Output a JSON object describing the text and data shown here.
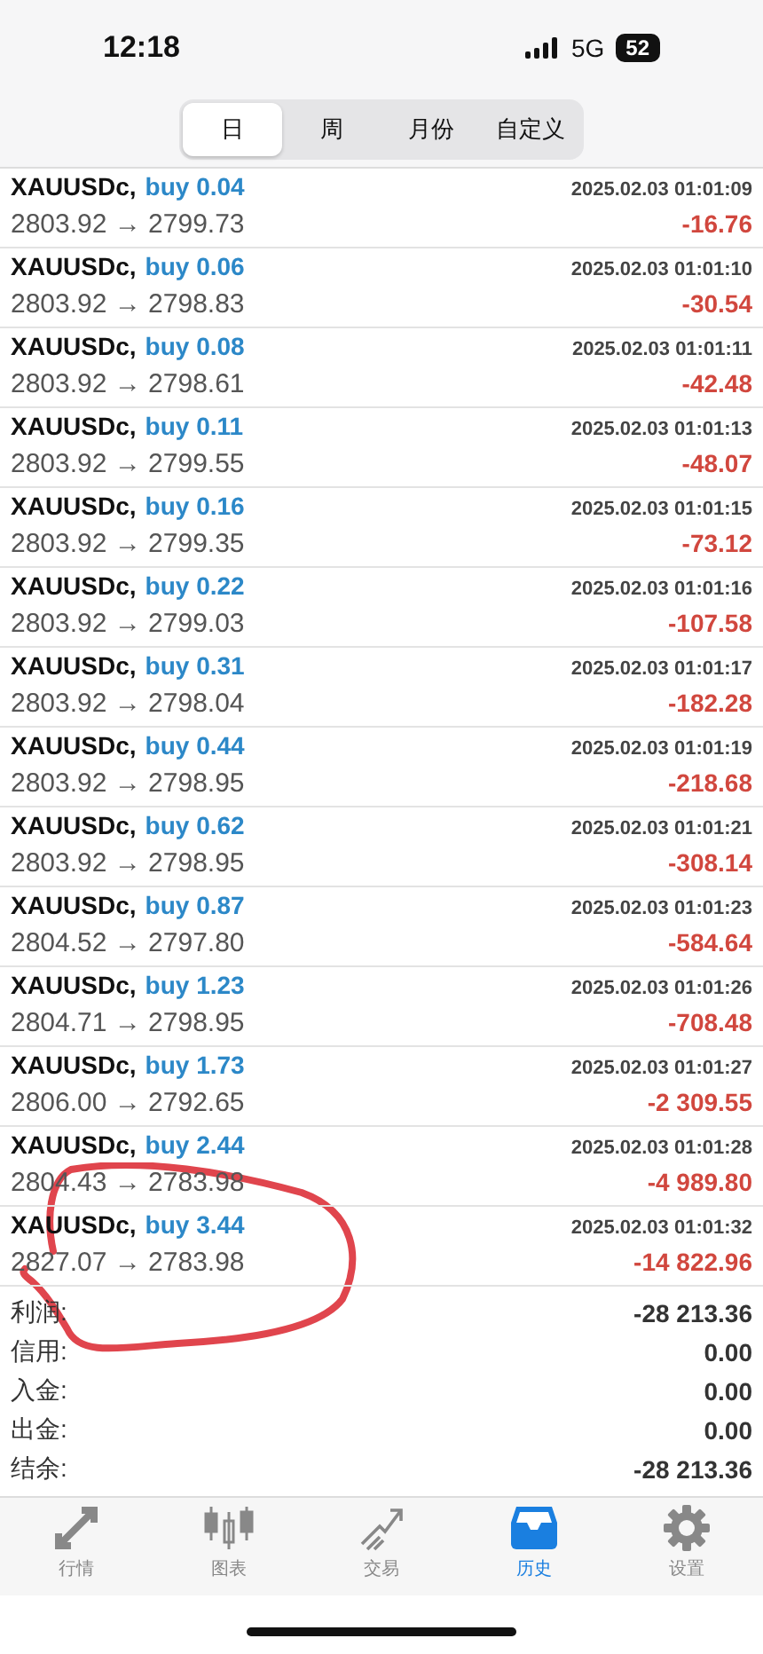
{
  "status_bar": {
    "time": "12:18",
    "network": "5G",
    "battery": "52"
  },
  "period_tabs": [
    {
      "label": "日",
      "selected": true
    },
    {
      "label": "周",
      "selected": false
    },
    {
      "label": "月份",
      "selected": false
    },
    {
      "label": "自定义",
      "selected": false
    }
  ],
  "deals": [
    {
      "symbol": "XAUUSDc,",
      "side": "buy 0.04",
      "time": "2025.02.03 01:01:09",
      "prices": "2803.92 → 2799.73",
      "profit": "-16.76"
    },
    {
      "symbol": "XAUUSDc,",
      "side": "buy 0.06",
      "time": "2025.02.03 01:01:10",
      "prices": "2803.92 → 2798.83",
      "profit": "-30.54"
    },
    {
      "symbol": "XAUUSDc,",
      "side": "buy 0.08",
      "time": "2025.02.03 01:01:11",
      "prices": "2803.92 → 2798.61",
      "profit": "-42.48"
    },
    {
      "symbol": "XAUUSDc,",
      "side": "buy 0.11",
      "time": "2025.02.03 01:01:13",
      "prices": "2803.92 → 2799.55",
      "profit": "-48.07"
    },
    {
      "symbol": "XAUUSDc,",
      "side": "buy 0.16",
      "time": "2025.02.03 01:01:15",
      "prices": "2803.92 → 2799.35",
      "profit": "-73.12"
    },
    {
      "symbol": "XAUUSDc,",
      "side": "buy 0.22",
      "time": "2025.02.03 01:01:16",
      "prices": "2803.92 → 2799.03",
      "profit": "-107.58"
    },
    {
      "symbol": "XAUUSDc,",
      "side": "buy 0.31",
      "time": "2025.02.03 01:01:17",
      "prices": "2803.92 → 2798.04",
      "profit": "-182.28"
    },
    {
      "symbol": "XAUUSDc,",
      "side": "buy 0.44",
      "time": "2025.02.03 01:01:19",
      "prices": "2803.92 → 2798.95",
      "profit": "-218.68"
    },
    {
      "symbol": "XAUUSDc,",
      "side": "buy 0.62",
      "time": "2025.02.03 01:01:21",
      "prices": "2803.92 → 2798.95",
      "profit": "-308.14"
    },
    {
      "symbol": "XAUUSDc,",
      "side": "buy 0.87",
      "time": "2025.02.03 01:01:23",
      "prices": "2804.52 → 2797.80",
      "profit": "-584.64"
    },
    {
      "symbol": "XAUUSDc,",
      "side": "buy 1.23",
      "time": "2025.02.03 01:01:26",
      "prices": "2804.71 → 2798.95",
      "profit": "-708.48"
    },
    {
      "symbol": "XAUUSDc,",
      "side": "buy 1.73",
      "time": "2025.02.03 01:01:27",
      "prices": "2806.00 → 2792.65",
      "profit": "-2 309.55"
    },
    {
      "symbol": "XAUUSDc,",
      "side": "buy 2.44",
      "time": "2025.02.03 01:01:28",
      "prices": "2804.43 → 2783.98",
      "profit": "-4 989.80"
    },
    {
      "symbol": "XAUUSDc,",
      "side": "buy 3.44",
      "time": "2025.02.03 01:01:32",
      "prices": "2827.07 → 2783.98",
      "profit": "-14 822.96"
    }
  ],
  "summary": [
    {
      "label": "利润:",
      "value": "-28 213.36"
    },
    {
      "label": "信用:",
      "value": "0.00"
    },
    {
      "label": "入金:",
      "value": "0.00"
    },
    {
      "label": "出金:",
      "value": "0.00"
    },
    {
      "label": "结余:",
      "value": "-28 213.36"
    }
  ],
  "tab_bar": [
    {
      "kind": "quotes",
      "label": "行情",
      "selected": false
    },
    {
      "kind": "chart",
      "label": "图表",
      "selected": false
    },
    {
      "kind": "trade",
      "label": "交易",
      "selected": false
    },
    {
      "kind": "history",
      "label": "历史",
      "selected": true
    },
    {
      "kind": "settings",
      "label": "设置",
      "selected": false
    }
  ]
}
